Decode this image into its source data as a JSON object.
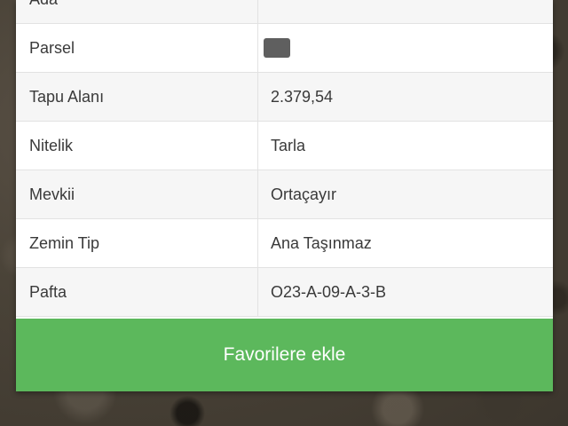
{
  "table": {
    "rows": [
      {
        "label": "Ada",
        "value": ""
      },
      {
        "label": "Parsel",
        "value": "",
        "redacted": true
      },
      {
        "label": "Tapu Alanı",
        "value": "2.379,54"
      },
      {
        "label": "Nitelik",
        "value": "Tarla"
      },
      {
        "label": "Mevkii",
        "value": "Ortaçayır"
      },
      {
        "label": "Zemin Tip",
        "value": "Ana Taşınmaz"
      },
      {
        "label": "Pafta",
        "value": "O23-A-09-A-3-B"
      }
    ]
  },
  "actions": {
    "favorite_label": "Favorilere ekle"
  },
  "colors": {
    "button_green": "#5cb85c"
  }
}
